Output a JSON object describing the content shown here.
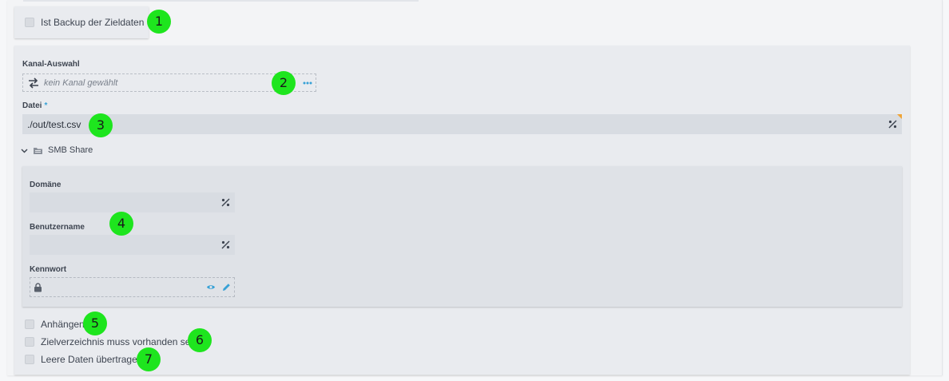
{
  "backup": {
    "label": "Ist Backup der Zieldaten",
    "checked": false
  },
  "channel": {
    "label": "Kanal-Auswahl",
    "placeholder": "kein Kanal gewählt"
  },
  "file": {
    "label": "Datei",
    "required_mark": "*",
    "value": "./out/test.csv"
  },
  "smb": {
    "title": "SMB Share",
    "domain_label": "Domäne",
    "domain_value": "",
    "username_label": "Benutzername",
    "username_value": "",
    "password_label": "Kennwort"
  },
  "options": [
    {
      "label": "Anhängen",
      "checked": false
    },
    {
      "label": "Zielverzeichnis muss vorhanden sein",
      "checked": false
    },
    {
      "label": "Leere Daten übertragen",
      "checked": false
    }
  ],
  "markers": [
    "1",
    "2",
    "3",
    "4",
    "5",
    "6",
    "7"
  ],
  "colors": {
    "accent": "#37a1d6",
    "marker": "#1ee51e",
    "modified_corner": "#f0a436"
  }
}
